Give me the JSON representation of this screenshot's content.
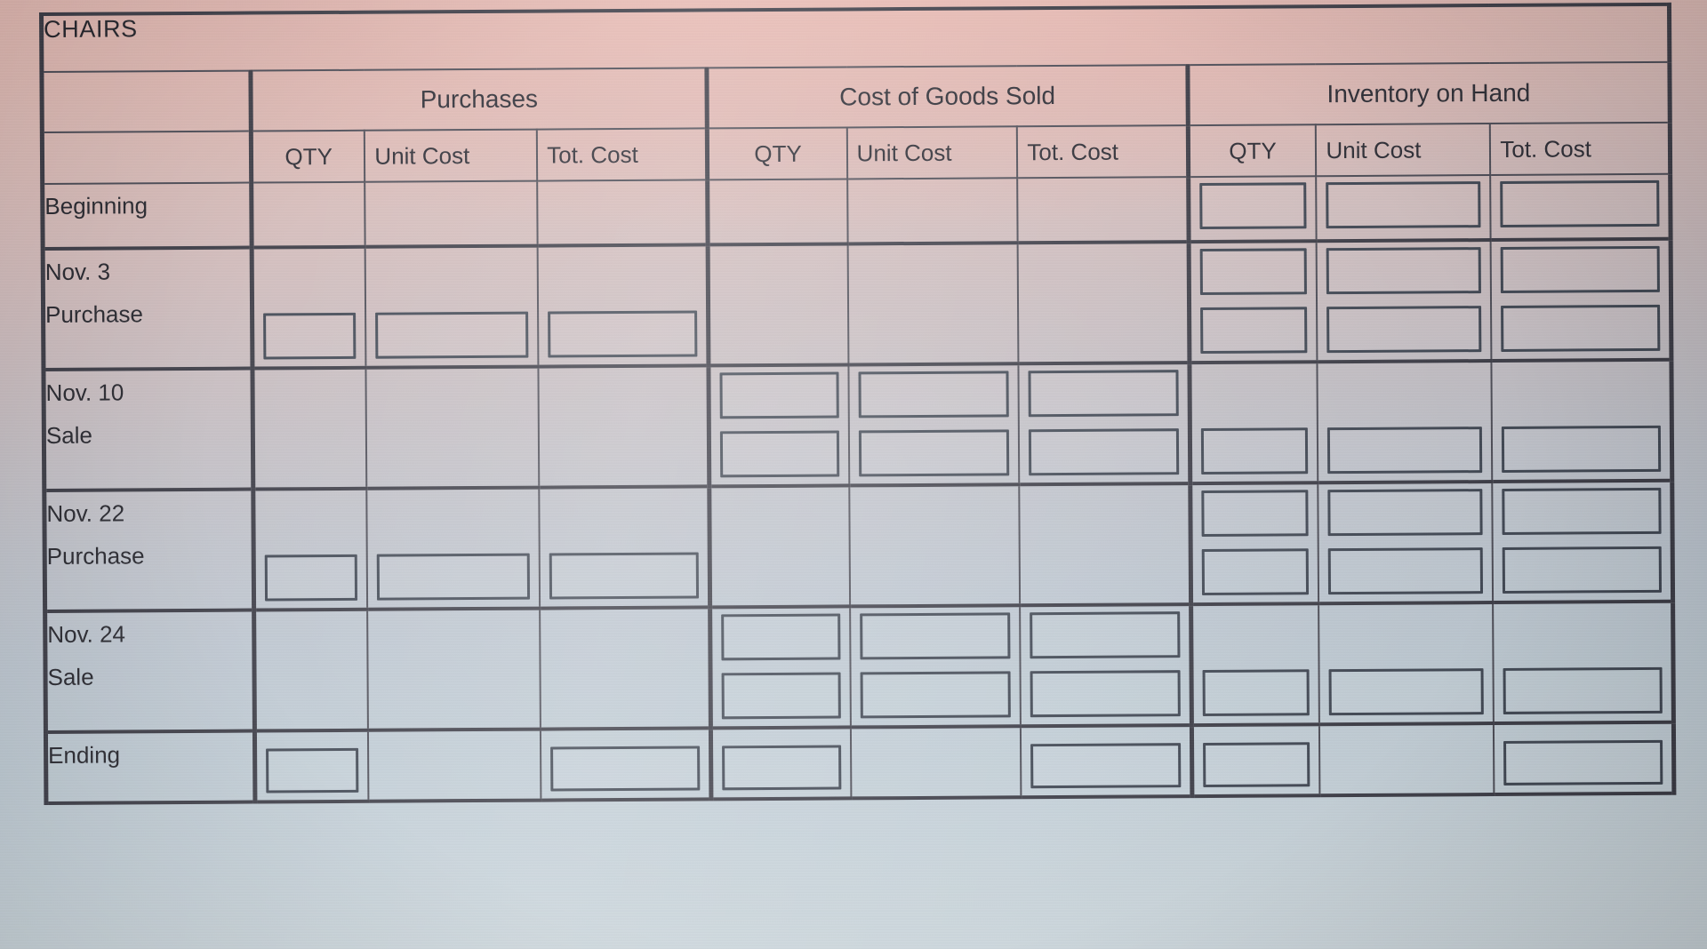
{
  "worksheet": {
    "title": "CHAIRS",
    "column_groups": [
      {
        "label": "Purchases"
      },
      {
        "label": "Cost of Goods Sold"
      },
      {
        "label": "Inventory on Hand"
      }
    ],
    "sub_headers": {
      "qty": "QTY",
      "unit_cost": "Unit Cost",
      "tot_cost": "Tot. Cost"
    },
    "rows": [
      {
        "line1": "Beginning",
        "line2": ""
      },
      {
        "line1": "Nov. 3",
        "line2": "Purchase"
      },
      {
        "line1": "Nov. 10",
        "line2": "Sale"
      },
      {
        "line1": "Nov. 22",
        "line2": "Purchase"
      },
      {
        "line1": "Nov. 24",
        "line2": "Sale"
      },
      {
        "line1": "Ending",
        "line2": ""
      }
    ],
    "colors": {
      "grid_line": "#4b4b55",
      "heavy_line": "#3b3b45",
      "input_border": "#3f4652",
      "text": "#26262d",
      "paper_top": "#e4bdb6",
      "paper_bottom": "#ccd6dc"
    }
  }
}
